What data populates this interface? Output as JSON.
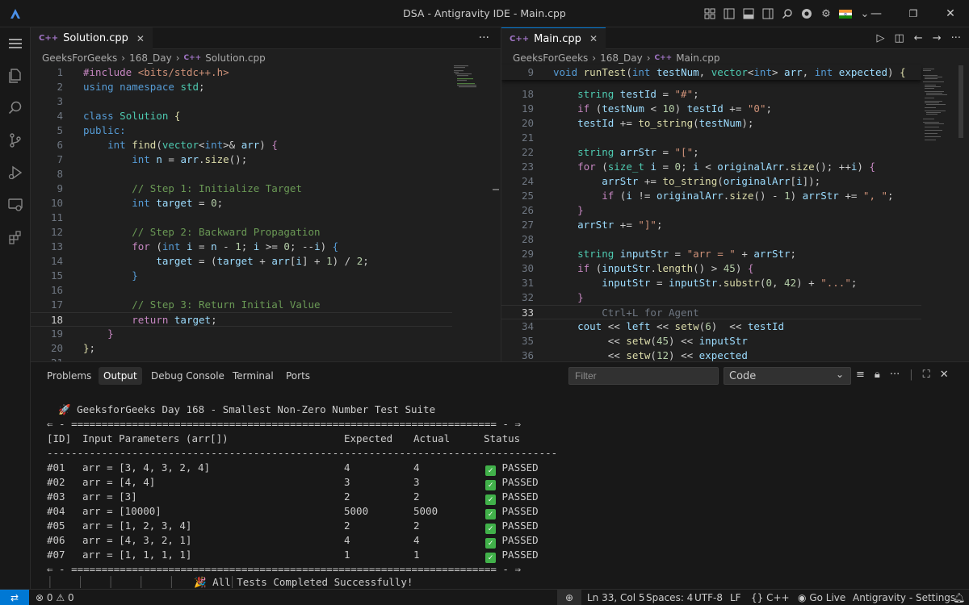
{
  "window": {
    "title": "DSA - Antigravity IDE - Main.cpp"
  },
  "title_icons": [
    "layout-icon",
    "split-left-icon",
    "panel-icon",
    "split-right-icon",
    "search-icon",
    "chrome-icon",
    "gear-icon",
    "flag-india-icon",
    "chevron-down-icon"
  ],
  "window_controls": {
    "minimize": "—",
    "restore": "❐",
    "close": "✕"
  },
  "activity": [
    "explorer-icon",
    "search-icon",
    "source-control-icon",
    "run-debug-icon",
    "remote-explorer-icon",
    "extensions-icon"
  ],
  "left_editor": {
    "tab": {
      "label": "Solution.cpp",
      "lang": "C++"
    },
    "breadcrumb": [
      "GeeksForGeeks",
      "168_Day",
      "Solution.cpp"
    ],
    "active_line": 18,
    "lines": [
      {
        "n": "1",
        "html": "<span class='pp'>#include</span> <span class='s'>&lt;bits/stdc++.h&gt;</span>"
      },
      {
        "n": "2",
        "html": "<span class='k'>using</span> <span class='k'>namespace</span> <span class='t'>std</span>;"
      },
      {
        "n": "3",
        "html": ""
      },
      {
        "n": "4",
        "html": "<span class='k'>class</span> <span class='t'>Solution</span> <span class='f'>{</span>"
      },
      {
        "n": "5",
        "html": "<span class='k'>public:</span>"
      },
      {
        "n": "6",
        "html": "    <span class='k'>int</span> <span class='f'>find</span>(<span class='t'>vector</span>&lt;<span class='k'>int</span>&gt;&amp; <span class='v'>arr</span>) <span class='c'>{</span>"
      },
      {
        "n": "7",
        "html": "        <span class='k'>int</span> <span class='v'>n</span> = <span class='v'>arr</span>.<span class='f'>size</span>();"
      },
      {
        "n": "8",
        "html": ""
      },
      {
        "n": "9",
        "html": "        <span class='cm'>// Step 1: Initialize Target</span>"
      },
      {
        "n": "10",
        "html": "        <span class='k'>int</span> <span class='v'>target</span> = <span class='n'>0</span>;"
      },
      {
        "n": "11",
        "html": ""
      },
      {
        "n": "12",
        "html": "        <span class='cm'>// Step 2: Backward Propagation</span>"
      },
      {
        "n": "13",
        "html": "        <span class='c'>for</span> (<span class='k'>int</span> <span class='v'>i</span> = <span class='v'>n</span> - <span class='n'>1</span>; <span class='v'>i</span> &gt;= <span class='n'>0</span>; --<span class='v'>i</span>) <span class='k'>{</span>"
      },
      {
        "n": "14",
        "html": "            <span class='v'>target</span> = (<span class='v'>target</span> + <span class='v'>arr</span>[<span class='v'>i</span>] + <span class='n'>1</span>) / <span class='n'>2</span>;"
      },
      {
        "n": "15",
        "html": "        <span class='k'>}</span>"
      },
      {
        "n": "16",
        "html": ""
      },
      {
        "n": "17",
        "html": "        <span class='cm'>// Step 3: Return Initial Value</span>"
      },
      {
        "n": "18",
        "html": "        <span class='c'>return</span> <span class='v'>target</span>;"
      },
      {
        "n": "19",
        "html": "    <span class='c'>}</span>"
      },
      {
        "n": "20",
        "html": "<span class='f'>}</span>;"
      },
      {
        "n": "21",
        "html": ""
      }
    ]
  },
  "right_editor": {
    "tab": {
      "label": "Main.cpp",
      "lang": "C++"
    },
    "breadcrumb": [
      "GeeksForGeeks",
      "168_Day",
      "Main.cpp"
    ],
    "sticky": {
      "n": "9",
      "html": "<span class='k'>void</span> <span class='f'>runTest</span>(<span class='k'>int</span> <span class='v'>testNum</span>, <span class='t'>vector</span>&lt;<span class='k'>int</span>&gt; <span class='v'>arr</span>, <span class='k'>int</span> <span class='v'>expected</span>) <span class='f'>{</span>"
    },
    "active_line": 33,
    "lines": [
      {
        "n": "18",
        "html": "    <span class='t'>string</span> <span class='v'>testId</span> = <span class='s'>\"#\"</span>;"
      },
      {
        "n": "19",
        "html": "    <span class='c'>if</span> (<span class='v'>testNum</span> &lt; <span class='n'>10</span>) <span class='v'>testId</span> += <span class='s'>\"0\"</span>;"
      },
      {
        "n": "20",
        "html": "    <span class='v'>testId</span> += <span class='f'>to_string</span>(<span class='v'>testNum</span>);"
      },
      {
        "n": "21",
        "html": ""
      },
      {
        "n": "22",
        "html": "    <span class='t'>string</span> <span class='v'>arrStr</span> = <span class='s'>\"[\"</span>;"
      },
      {
        "n": "23",
        "html": "    <span class='c'>for</span> (<span class='t'>size_t</span> <span class='v'>i</span> = <span class='n'>0</span>; <span class='v'>i</span> &lt; <span class='v'>originalArr</span>.<span class='f'>size</span>(); ++<span class='v'>i</span>) <span class='c'>{</span>"
      },
      {
        "n": "24",
        "html": "        <span class='v'>arrStr</span> += <span class='f'>to_string</span>(<span class='v'>originalArr</span>[<span class='v'>i</span>]);"
      },
      {
        "n": "25",
        "html": "        <span class='c'>if</span> (<span class='v'>i</span> != <span class='v'>originalArr</span>.<span class='f'>size</span>() - <span class='n'>1</span>) <span class='v'>arrStr</span> += <span class='s'>\", \"</span>;"
      },
      {
        "n": "26",
        "html": "    <span class='c'>}</span>"
      },
      {
        "n": "27",
        "html": "    <span class='v'>arrStr</span> += <span class='s'>\"]\"</span>;"
      },
      {
        "n": "28",
        "html": ""
      },
      {
        "n": "29",
        "html": "    <span class='t'>string</span> <span class='v'>inputStr</span> = <span class='s'>\"arr = \"</span> + <span class='v'>arrStr</span>;"
      },
      {
        "n": "30",
        "html": "    <span class='c'>if</span> (<span class='v'>inputStr</span>.<span class='f'>length</span>() &gt; <span class='n'>45</span>) <span class='c'>{</span>"
      },
      {
        "n": "31",
        "html": "        <span class='v'>inputStr</span> = <span class='v'>inputStr</span>.<span class='f'>substr</span>(<span class='n'>0</span>, <span class='n'>42</span>) + <span class='s'>\"...\"</span>;"
      },
      {
        "n": "32",
        "html": "    <span class='c'>}</span>"
      },
      {
        "n": "33",
        "html": "        <span class='ghost'>Ctrl+L for Agent</span>"
      },
      {
        "n": "34",
        "html": "    <span class='v'>cout</span> &lt;&lt; <span class='v'>left</span> &lt;&lt; <span class='f'>setw</span>(<span class='n'>6</span>)  &lt;&lt; <span class='v'>testId</span>"
      },
      {
        "n": "35",
        "html": "         &lt;&lt; <span class='f'>setw</span>(<span class='n'>45</span>) &lt;&lt; <span class='v'>inputStr</span>"
      },
      {
        "n": "36",
        "html": "         &lt;&lt; <span class='f'>setw</span>(<span class='n'>12</span>) &lt;&lt; <span class='v'>expected</span>"
      }
    ]
  },
  "panel": {
    "tabs": [
      "Problems",
      "Output",
      "Debug Console",
      "Terminal",
      "Ports"
    ],
    "active_tab": "Output",
    "filter_placeholder": "Filter",
    "channel": "Code",
    "output": {
      "header": "🚀 GeeksforGeeks Day 168 - Smallest Non-Zero Number Test Suite",
      "rule_top": "⇐ - ====================================================================== - ⇒",
      "columns": [
        "[ID]",
        "Input Parameters (arr[])",
        "Expected",
        "Actual",
        "Status"
      ],
      "dash_rule": "------------------------------------------------------------------------------------",
      "rows": [
        {
          "id": "#01",
          "input": "arr = [3, 4, 3, 2, 4]",
          "expected": "4",
          "actual": "4",
          "status": "PASSED"
        },
        {
          "id": "#02",
          "input": "arr = [4, 4]",
          "expected": "3",
          "actual": "3",
          "status": "PASSED"
        },
        {
          "id": "#03",
          "input": "arr = [3]",
          "expected": "2",
          "actual": "2",
          "status": "PASSED"
        },
        {
          "id": "#04",
          "input": "arr = [10000]",
          "expected": "5000",
          "actual": "5000",
          "status": "PASSED"
        },
        {
          "id": "#05",
          "input": "arr = [1, 2, 3, 4]",
          "expected": "2",
          "actual": "2",
          "status": "PASSED"
        },
        {
          "id": "#06",
          "input": "arr = [4, 3, 2, 1]",
          "expected": "4",
          "actual": "4",
          "status": "PASSED"
        },
        {
          "id": "#07",
          "input": "arr = [1, 1, 1, 1]",
          "expected": "1",
          "actual": "1",
          "status": "PASSED"
        }
      ],
      "rule_bottom": "⇐ - ====================================================================== - ⇒",
      "footer": "🎉 All Tests Completed Successfully!"
    }
  },
  "statusbar": {
    "errors": "0",
    "warnings": "0",
    "position": "Ln 33, Col 5",
    "spaces": "Spaces: 4",
    "encoding": "UTF-8",
    "eol": "LF",
    "language": "C++",
    "live": "Go Live",
    "settings": "Antigravity - Settings"
  }
}
